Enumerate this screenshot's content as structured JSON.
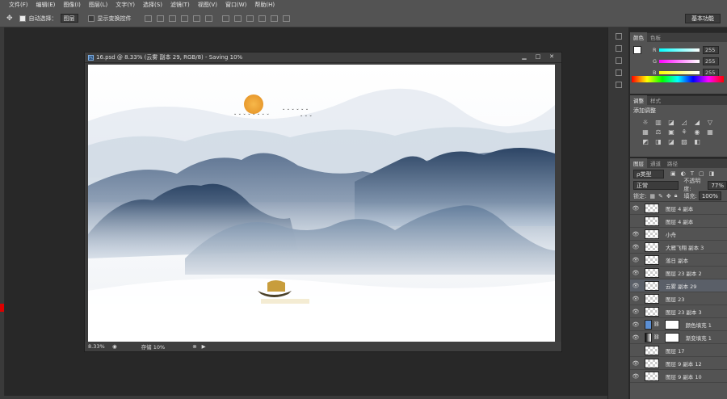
{
  "menu": [
    "文件(F)",
    "编辑(E)",
    "图像(I)",
    "图层(L)",
    "文字(Y)",
    "选择(S)",
    "滤镜(T)",
    "视图(V)",
    "窗口(W)",
    "帮助(H)"
  ],
  "options": {
    "auto_select_label": "自动选择：",
    "auto_select_value": "图层",
    "transform_label": "显示变换控件",
    "workspace_button": "基本功能"
  },
  "document": {
    "title": "16.psd @ 8.33% (云雾 副本 29, RGB/8) - Saving 10%",
    "badge": "Ps",
    "zoom": "8.33%",
    "status": "存储 10%"
  },
  "color_panel": {
    "tabs": [
      "颜色",
      "色板"
    ],
    "channels": [
      {
        "label": "R",
        "value": "255"
      },
      {
        "label": "G",
        "value": "255"
      },
      {
        "label": "B",
        "value": "255"
      }
    ]
  },
  "adjust_panel": {
    "tabs": [
      "调整",
      "样式"
    ],
    "heading": "添加调整",
    "icons": [
      "☼",
      "▥",
      "◪",
      "◿",
      "◢",
      "▽",
      "▦",
      "⚖",
      "▣",
      "⚘",
      "◉",
      "▦",
      "◩",
      "◨",
      "◪",
      "▨",
      "◧",
      ""
    ]
  },
  "layers_panel": {
    "tabs": [
      "图层",
      "通道",
      "路径"
    ],
    "filter_label": "ρ类型",
    "blend_mode": "正常",
    "opacity_label": "不透明度:",
    "opacity_value": "77%",
    "lock_label": "锁定:",
    "fill_label": "填充:",
    "fill_value": "100%",
    "layers": [
      {
        "name": "图层 4 副本",
        "visible": true,
        "thumb": "checker"
      },
      {
        "name": "图层 4 副本",
        "visible": false,
        "thumb": "checker"
      },
      {
        "name": "小舟",
        "visible": true,
        "thumb": "checker"
      },
      {
        "name": "大雁飞翔 副本 3",
        "visible": true,
        "thumb": "checker"
      },
      {
        "name": "落日 副本",
        "visible": true,
        "thumb": "checker"
      },
      {
        "name": "图层 23 副本 2",
        "visible": true,
        "thumb": "checker"
      },
      {
        "name": "云雾 副本 29",
        "visible": true,
        "thumb": "checker",
        "selected": true
      },
      {
        "name": "图层 23",
        "visible": true,
        "thumb": "checker"
      },
      {
        "name": "图层 23 副本 3",
        "visible": true,
        "thumb": "checker"
      },
      {
        "name": "颜色填充 1",
        "visible": true,
        "thumb": "fill-blue"
      },
      {
        "name": "渐变填充 1",
        "visible": true,
        "thumb": "fill-gradient"
      },
      {
        "name": "图层 17",
        "visible": false,
        "thumb": "checker"
      },
      {
        "name": "图层 9 副本 12",
        "visible": true,
        "thumb": "checker"
      },
      {
        "name": "图层 9 副本 10",
        "visible": true,
        "thumb": "checker"
      }
    ]
  },
  "colors": {
    "sun": "#f2a93b",
    "mountain": "#3c5a7a",
    "ui_bg": "#535353"
  }
}
